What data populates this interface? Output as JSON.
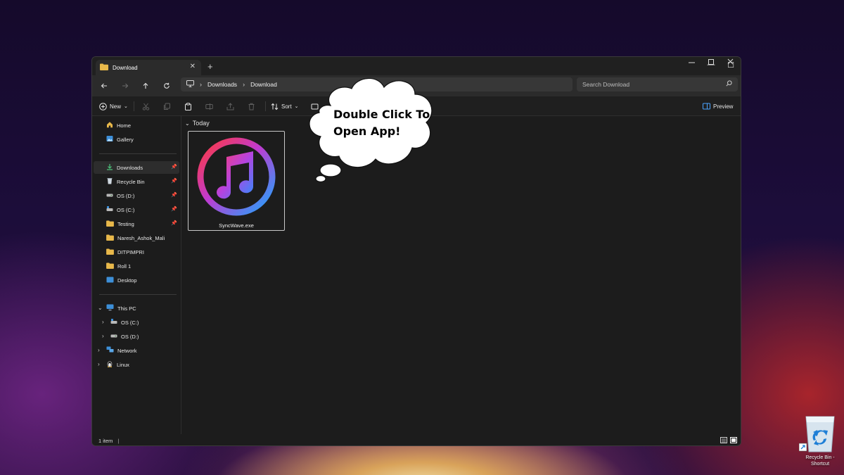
{
  "window": {
    "tab_title": "Download",
    "new_tab": "+",
    "controls": {
      "minimize": "—",
      "maximize": "☐",
      "close": "✕"
    }
  },
  "address_bar": {
    "crumbs": [
      "Downloads",
      "Download"
    ],
    "search_placeholder": "Search Download"
  },
  "toolbar": {
    "new_label": "New",
    "sort_label": "Sort",
    "preview_label": "Preview"
  },
  "sidebar": {
    "quick": [
      {
        "label": "Home",
        "icon": "home-icon"
      },
      {
        "label": "Gallery",
        "icon": "gallery-icon"
      }
    ],
    "pinned": [
      {
        "label": "Downloads",
        "icon": "download-icon",
        "pinned": true,
        "selected": true
      },
      {
        "label": "Recycle Bin",
        "icon": "recycle-bin-icon",
        "pinned": true
      },
      {
        "label": "OS (D:)",
        "icon": "drive-icon",
        "pinned": true
      },
      {
        "label": "OS (C:)",
        "icon": "drive-icon",
        "pinned": true
      },
      {
        "label": "Testing",
        "icon": "folder-icon",
        "pinned": true
      },
      {
        "label": "Naresh_Ashok_Mali",
        "icon": "folder-icon"
      },
      {
        "label": "DITPIMPRI",
        "icon": "folder-icon"
      },
      {
        "label": "Roll 1",
        "icon": "folder-icon"
      },
      {
        "label": "Desktop",
        "icon": "desktop-icon"
      }
    ],
    "tree": [
      {
        "label": "This PC",
        "icon": "pc-icon",
        "expanded": true
      },
      {
        "label": "OS (C:)",
        "icon": "drive-icon"
      },
      {
        "label": "OS (D:)",
        "icon": "drive-icon"
      },
      {
        "label": "Network",
        "icon": "network-icon"
      },
      {
        "label": "Linux",
        "icon": "linux-icon"
      }
    ]
  },
  "content": {
    "group": "Today",
    "file": {
      "name": "SyncWave.exe",
      "icon": "music-note-icon"
    }
  },
  "status": {
    "count": "1 item"
  },
  "callout": {
    "text": "Double Click To Open App!"
  },
  "desktop": {
    "shortcut_label": "Recycle Bin - Shortcut"
  },
  "colors": {
    "accent": "#4aa3ff",
    "folder": "#e8b84a",
    "window_bg": "#1c1c1c"
  }
}
